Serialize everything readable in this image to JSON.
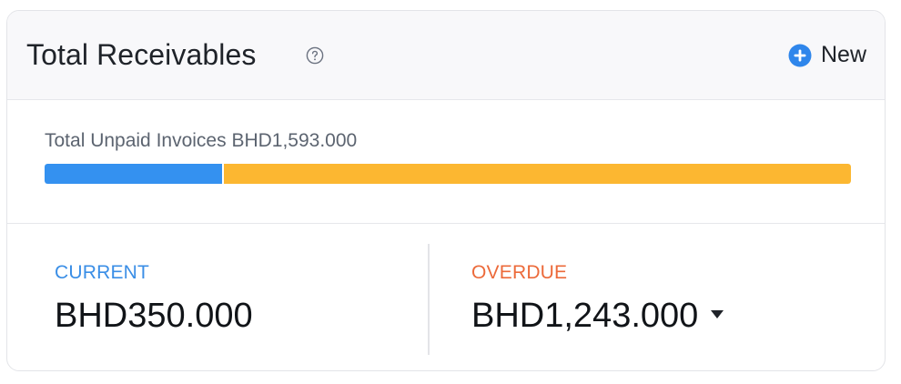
{
  "header": {
    "title": "Total Receivables",
    "help_icon": "question-circle-icon",
    "new_button": {
      "label": "New",
      "icon": "plus-circle-icon"
    }
  },
  "unpaid": {
    "text": "Total Unpaid Invoices BHD1,593.000",
    "total": 1593.0,
    "current_amount": 350.0,
    "overdue_amount": 1243.0
  },
  "current": {
    "label": "CURRENT",
    "value": "BHD350.000"
  },
  "overdue": {
    "label": "OVERDUE",
    "value": "BHD1,243.000",
    "dropdown_icon": "caret-down-icon"
  },
  "colors": {
    "current": "#3491f0",
    "overdue": "#fcb731",
    "current_label": "#3a8ee6",
    "overdue_label": "#ec6a3a",
    "accent": "#2f86eb"
  }
}
